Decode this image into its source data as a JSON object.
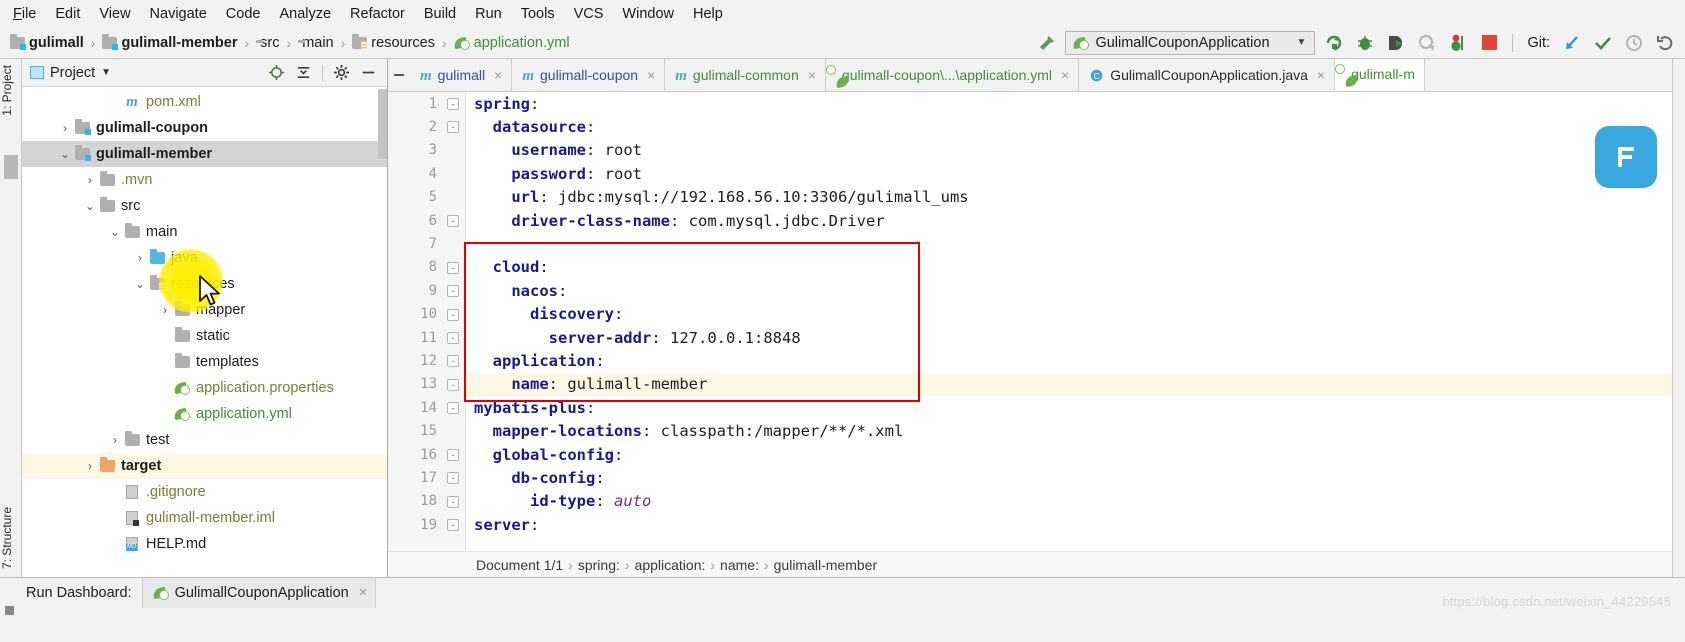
{
  "menubar": {
    "items": [
      "File",
      "Edit",
      "View",
      "Navigate",
      "Code",
      "Analyze",
      "Refactor",
      "Build",
      "Run",
      "Tools",
      "VCS",
      "Window",
      "Help"
    ]
  },
  "navbar": {
    "crumbs": [
      {
        "label": "gulimall",
        "icon": "module-folder-icon"
      },
      {
        "label": "gulimall-member",
        "icon": "module-folder-icon"
      },
      {
        "label": "src",
        "icon": "folder-icon"
      },
      {
        "label": "main",
        "icon": "folder-icon"
      },
      {
        "label": "resources",
        "icon": "resources-folder-icon"
      },
      {
        "label": "application.yml",
        "icon": "spring-yml-icon"
      }
    ],
    "separator": "›",
    "run_configuration": "GulimallCouponApplication",
    "run_config_icon": "spring-boot-icon",
    "dropdown_icon": "chevron-down-icon",
    "hammer_icon": "build-hammer-icon",
    "toolbar_icons": [
      "rerun-icon",
      "debug-icon",
      "run-with-coverage-icon",
      "profile-icon",
      "stop-dumb-icon",
      "stop-icon"
    ],
    "git_label": "Git:",
    "git_icons": [
      "update-project-icon",
      "commit-icon",
      "history-icon",
      "rollback-icon"
    ]
  },
  "left_strip": {
    "project_tab": "1: Project",
    "structure_tab": "7: Structure"
  },
  "project_panel": {
    "title": "Project",
    "title_dropdown": "chevron-down-icon",
    "header_icons": [
      "locate-icon",
      "collapse-all-icon",
      "gear-icon",
      "hide-icon"
    ],
    "tree": [
      {
        "label": "pom.xml",
        "depth": 3,
        "twist": "",
        "icon": "maven-icon",
        "style": "olive",
        "state": "normal"
      },
      {
        "label": "gulimall-coupon",
        "depth": 1,
        "twist": "›",
        "icon": "module-folder-icon",
        "style": "bold",
        "state": "normal"
      },
      {
        "label": "gulimall-member",
        "depth": 1,
        "twist": "⌄",
        "icon": "module-folder-icon",
        "style": "bold",
        "state": "selected"
      },
      {
        "label": ".mvn",
        "depth": 2,
        "twist": "›",
        "icon": "folder-icon",
        "style": "olive",
        "state": "normal"
      },
      {
        "label": "src",
        "depth": 2,
        "twist": "⌄",
        "icon": "folder-icon",
        "style": "dark",
        "state": "normal"
      },
      {
        "label": "main",
        "depth": 3,
        "twist": "⌄",
        "icon": "folder-icon",
        "style": "dark",
        "state": "normal"
      },
      {
        "label": "java",
        "depth": 4,
        "twist": "›",
        "icon": "source-folder-icon",
        "style": "dark",
        "state": "normal"
      },
      {
        "label": "resources",
        "depth": 4,
        "twist": "⌄",
        "icon": "resources-folder-icon",
        "style": "dark",
        "state": "normal"
      },
      {
        "label": "mapper",
        "depth": 5,
        "twist": "›",
        "icon": "folder-icon",
        "style": "dark",
        "state": "normal"
      },
      {
        "label": "static",
        "depth": 5,
        "twist": "",
        "icon": "folder-icon",
        "style": "dark",
        "state": "normal"
      },
      {
        "label": "templates",
        "depth": 5,
        "twist": "",
        "icon": "folder-icon",
        "style": "dark",
        "state": "normal"
      },
      {
        "label": "application.properties",
        "depth": 5,
        "twist": "",
        "icon": "spring-yml-icon",
        "style": "olive",
        "state": "normal"
      },
      {
        "label": "application.yml",
        "depth": 5,
        "twist": "",
        "icon": "spring-yml-icon",
        "style": "green",
        "state": "normal"
      },
      {
        "label": "test",
        "depth": 3,
        "twist": "›",
        "icon": "folder-icon",
        "style": "dark",
        "state": "normal"
      },
      {
        "label": "target",
        "depth": 2,
        "twist": "›",
        "icon": "target-folder-icon",
        "style": "bold",
        "state": "highlight"
      },
      {
        "label": ".gitignore",
        "depth": 3,
        "twist": "",
        "icon": "file-icon",
        "style": "olive",
        "state": "normal"
      },
      {
        "label": "gulimall-member.iml",
        "depth": 3,
        "twist": "",
        "icon": "iml-icon",
        "style": "olive",
        "state": "normal"
      },
      {
        "label": "HELP.md",
        "depth": 3,
        "twist": "",
        "icon": "markdown-icon",
        "style": "dark",
        "state": "normal"
      }
    ]
  },
  "editor": {
    "tabs": [
      {
        "label": "gulimall",
        "icon": "maven-icon",
        "color": "blue",
        "active": false,
        "close": "×"
      },
      {
        "label": "gulimall-coupon",
        "icon": "maven-icon",
        "color": "blue",
        "active": false,
        "close": "×"
      },
      {
        "label": "gulimall-common",
        "icon": "maven-icon",
        "color": "green",
        "active": false,
        "close": "×"
      },
      {
        "label": "gulimall-coupon\\...\\application.yml",
        "icon": "spring-yml-icon",
        "color": "green",
        "active": false,
        "close": "×"
      },
      {
        "label": "GulimallCouponApplication.java",
        "icon": "java-class-icon",
        "color": "dark",
        "active": false,
        "close": "×"
      },
      {
        "label": "gulimall-m",
        "icon": "spring-yml-icon",
        "color": "green",
        "active": true,
        "close": ""
      }
    ],
    "lines": [
      {
        "n": 1,
        "indent": 0,
        "key": "spring",
        "sep": ":",
        "value": "",
        "fold": "-",
        "highlight": false
      },
      {
        "n": 2,
        "indent": 1,
        "key": "datasource",
        "sep": ":",
        "value": "",
        "fold": "-",
        "highlight": false
      },
      {
        "n": 3,
        "indent": 2,
        "key": "username",
        "sep": ":",
        "value": "root",
        "fold": "",
        "highlight": false
      },
      {
        "n": 4,
        "indent": 2,
        "key": "password",
        "sep": ":",
        "value": "root",
        "fold": "",
        "highlight": false
      },
      {
        "n": 5,
        "indent": 2,
        "key": "url",
        "sep": ":",
        "value": "jdbc:mysql://192.168.56.10:3306/gulimall_ums",
        "fold": "",
        "highlight": false
      },
      {
        "n": 6,
        "indent": 2,
        "key": "driver-class-name",
        "sep": ":",
        "value": "com.mysql.jdbc.Driver",
        "fold": "-",
        "highlight": false
      },
      {
        "n": 7,
        "indent": 0,
        "key": "",
        "sep": "",
        "value": "",
        "fold": "",
        "highlight": false
      },
      {
        "n": 8,
        "indent": 1,
        "key": "cloud",
        "sep": ":",
        "value": "",
        "fold": "-",
        "highlight": false
      },
      {
        "n": 9,
        "indent": 2,
        "key": "nacos",
        "sep": ":",
        "value": "",
        "fold": "-",
        "highlight": false
      },
      {
        "n": 10,
        "indent": 3,
        "key": "discovery",
        "sep": ":",
        "value": "",
        "fold": "-",
        "highlight": false
      },
      {
        "n": 11,
        "indent": 4,
        "key": "server-addr",
        "sep": ":",
        "value": "127.0.0.1:8848",
        "fold": "-",
        "highlight": false
      },
      {
        "n": 12,
        "indent": 1,
        "key": "application",
        "sep": ":",
        "value": "",
        "fold": "-",
        "highlight": false
      },
      {
        "n": 13,
        "indent": 2,
        "key": "name",
        "sep": ":",
        "value": "gulimall-member",
        "fold": "-",
        "highlight": true
      },
      {
        "n": 14,
        "indent": 0,
        "key": "mybatis-plus",
        "sep": ":",
        "value": "",
        "fold": "-",
        "highlight": false
      },
      {
        "n": 15,
        "indent": 1,
        "key": "mapper-locations",
        "sep": ":",
        "value": "classpath:/mapper/**/*.xml",
        "fold": "",
        "highlight": false
      },
      {
        "n": 16,
        "indent": 1,
        "key": "global-config",
        "sep": ":",
        "value": "",
        "fold": "-",
        "highlight": false
      },
      {
        "n": 17,
        "indent": 2,
        "key": "db-config",
        "sep": ":",
        "value": "",
        "fold": "-",
        "highlight": false
      },
      {
        "n": 18,
        "indent": 3,
        "key": "id-type",
        "sep": ":",
        "value": "auto",
        "fold": "-",
        "highlight": false,
        "italic": true
      },
      {
        "n": 19,
        "indent": 0,
        "key": "server",
        "sep": ":",
        "value": "",
        "fold": "-",
        "highlight": false
      }
    ],
    "annotation_box_color": "#e00000",
    "breadcrumb": [
      "Document 1/1",
      "spring:",
      "application:",
      "name:",
      "gulimall-member"
    ],
    "breadcrumb_separator": "›"
  },
  "bottom": {
    "run_dashboard_label": "Run Dashboard:",
    "active_tab": "GulimallCouponApplication",
    "active_tab_icon": "spring-boot-icon",
    "active_tab_close": "×",
    "watermark": "https://blog.csdn.net/weixin_44229545"
  },
  "colors": {
    "accent_red": "#e00000",
    "highlight_yellow": "#fdf8e3",
    "cursor_glow": "#ffee00",
    "key_blue": "#1a1a8c",
    "green_text": "#3e8f3e",
    "olive_text": "#7c7c34"
  }
}
